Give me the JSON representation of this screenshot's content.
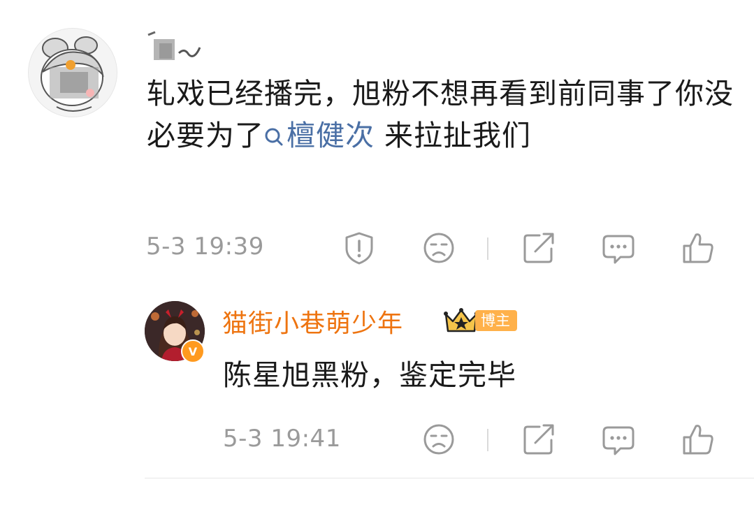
{
  "comment": {
    "text_before": "轧戏已经播完，旭粉不想再看到前同事了你没必要为了",
    "mention": "檀健次",
    "text_after": " 来拉扯我们",
    "time": "5-3 19:39"
  },
  "reply": {
    "username": "猫街小巷萌少年",
    "badge": "博主",
    "text": "陈星旭黑粉，鉴定完毕",
    "time": "5-3 19:41"
  },
  "colors": {
    "username": "#ee7410",
    "mention": "#4a6fa5",
    "badge": "#ffb14a",
    "meta": "#9a9a9a"
  },
  "icons": [
    "report-icon",
    "dislike-icon",
    "share-icon",
    "comment-icon",
    "like-icon",
    "search-icon",
    "crown-icon",
    "verified-icon"
  ]
}
